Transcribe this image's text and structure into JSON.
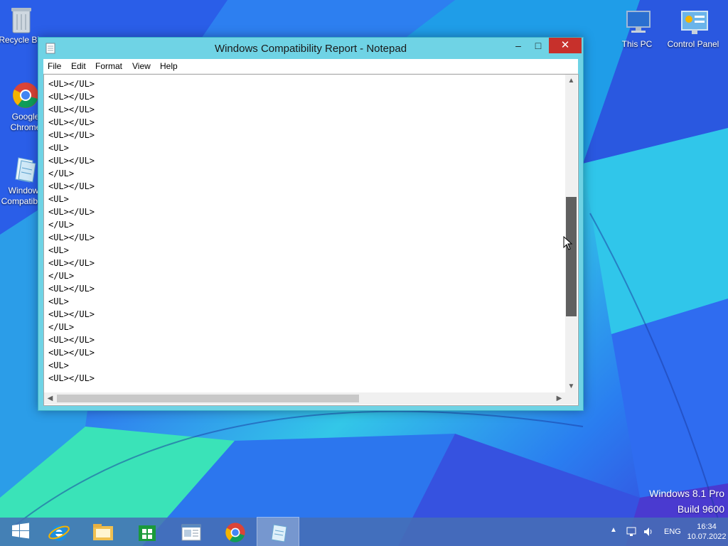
{
  "desktop": {
    "icons": [
      {
        "label": "Recycle Bin",
        "icon": "recycle-bin-icon"
      },
      {
        "label": "Google Chrome",
        "icon": "chrome-icon"
      },
      {
        "label": "Windows Compatibility",
        "icon": "notepad-document-icon"
      },
      {
        "label": "This PC",
        "icon": "computer-icon"
      },
      {
        "label": "Control Panel",
        "icon": "control-panel-icon"
      }
    ],
    "brand_line1": "Windows 8.1 Pro",
    "brand_line2": "Build 9600"
  },
  "window": {
    "title": "Windows Compatibility Report - Notepad",
    "controls": {
      "minimize": "–",
      "maximize": "□",
      "close": "✕"
    },
    "menu": [
      "File",
      "Edit",
      "Format",
      "View",
      "Help"
    ],
    "lines": [
      "<UL></UL>",
      "<UL></UL>",
      "<UL></UL>",
      "<UL></UL>",
      "<UL></UL>",
      "<UL>",
      "<UL></UL>",
      "</UL>",
      "<UL></UL>",
      "<UL>",
      "<UL></UL>",
      "</UL>",
      "<UL></UL>",
      "<UL>",
      "<UL></UL>",
      "</UL>",
      "<UL></UL>",
      "<UL>",
      "<UL></UL>",
      "</UL>",
      "<UL></UL>",
      "<UL></UL>",
      "<UL>",
      "<UL></UL>"
    ],
    "scroll": {
      "vertical_position": 0.39,
      "horizontal_visible_fraction": 0.6
    }
  },
  "taskbar": {
    "items": [
      {
        "icon": "start-icon"
      },
      {
        "icon": "internet-explorer-icon"
      },
      {
        "icon": "file-explorer-icon"
      },
      {
        "icon": "store-icon"
      },
      {
        "icon": "document-viewer-icon"
      },
      {
        "icon": "chrome-icon"
      },
      {
        "icon": "notepad-icon",
        "active": true
      }
    ],
    "tray": {
      "language": "ENG",
      "time": "16:34",
      "date": "10.07.2022"
    }
  },
  "colors": {
    "close_button": "#c7302b",
    "window_frame": "#6fd3e5",
    "taskbar": "#466eb4"
  }
}
